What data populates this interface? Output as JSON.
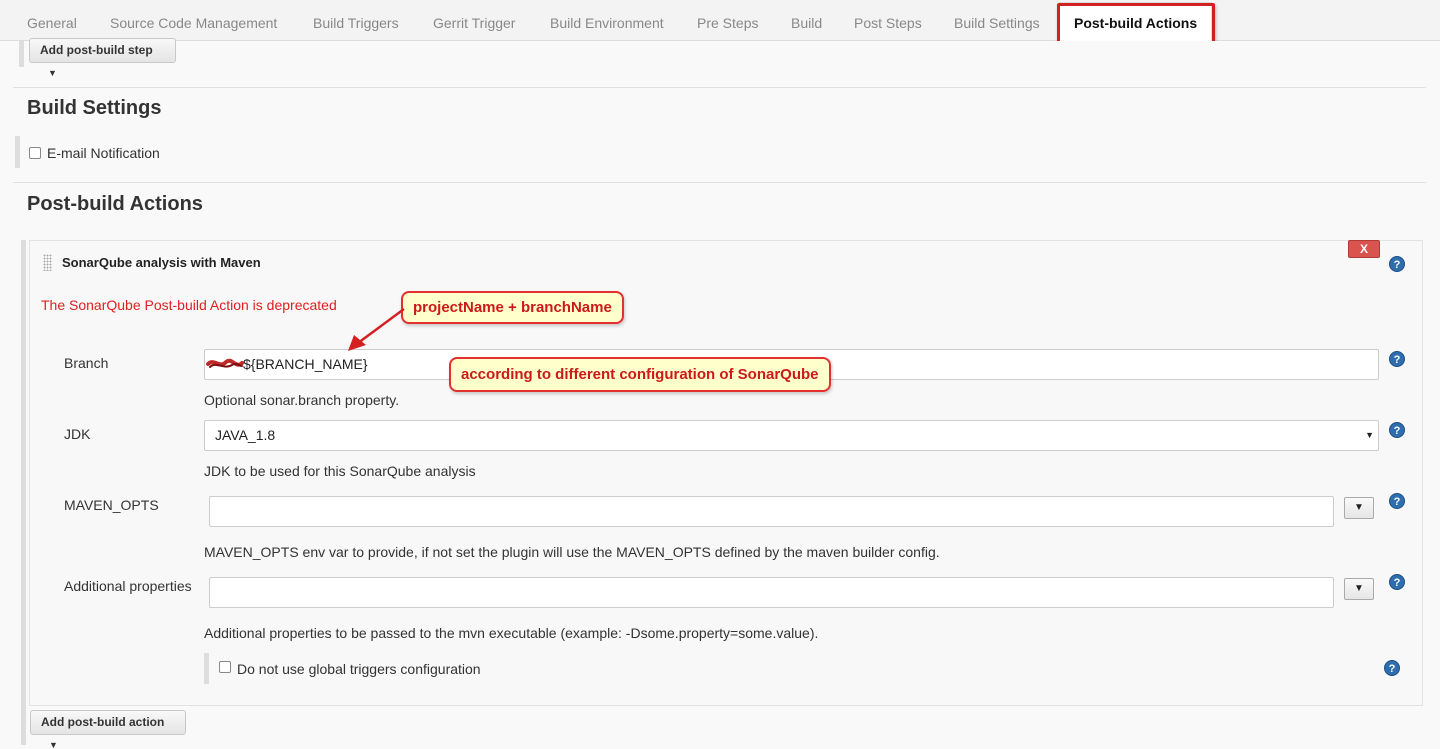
{
  "tabs": [
    "General",
    "Source Code Management",
    "Build Triggers",
    "Gerrit Trigger",
    "Build Environment",
    "Pre Steps",
    "Build",
    "Post Steps",
    "Build Settings",
    "Post-build Actions"
  ],
  "active_tab": "Post-build Actions",
  "add_post_build_step": "Add post-build step",
  "build_settings": {
    "title": "Build Settings",
    "email_label": "E-mail Notification"
  },
  "post_build": {
    "title": "Post-build Actions",
    "panel_title": "SonarQube analysis with Maven",
    "delete_label": "X",
    "deprecated_warning": "The SonarQube Post-build Action is deprecated",
    "branch": {
      "label": "Branch",
      "value": "${BRANCH_NAME}",
      "description": "Optional sonar.branch property."
    },
    "jdk": {
      "label": "JDK",
      "value": "JAVA_1.8",
      "description": "JDK to be used for this SonarQube analysis"
    },
    "maven_opts": {
      "label": "MAVEN_OPTS",
      "value": "",
      "description": "MAVEN_OPTS env var to provide, if not set the plugin will use the MAVEN_OPTS defined by the maven builder config."
    },
    "additional_properties": {
      "label": "Additional properties",
      "value": "",
      "description": "Additional properties to be passed to the mvn executable (example: -Dsome.property=some.value)."
    },
    "global_triggers_label": "Do not use global triggers configuration",
    "add_post_build_action": "Add post-build action"
  },
  "annotations": {
    "callout1": "projectName + branchName",
    "callout2": "according to different configuration of SonarQube"
  },
  "help_glyph": "?",
  "colors": {
    "warning": "#e02020",
    "callout_border": "#e53030",
    "callout_fill": "#ffffcc",
    "delete_button": "#d9534f",
    "help_icon": "#2e6eae"
  }
}
